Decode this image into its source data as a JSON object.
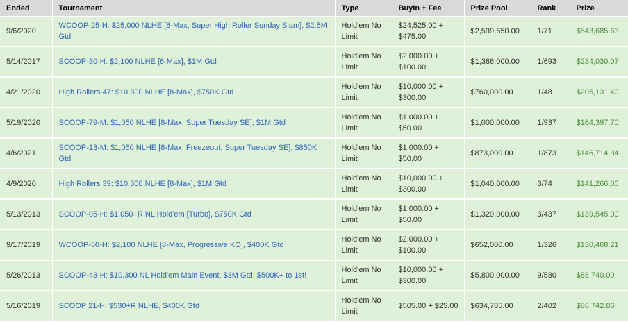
{
  "columns": [
    "Ended",
    "Tournament",
    "Type",
    "BuyIn + Fee",
    "Prize Pool",
    "Rank",
    "Prize"
  ],
  "rows": [
    {
      "ended": "9/6/2020",
      "tournament": "WCOOP-25-H: $25,000 NLHE [8-Max, Super High Roller Sunday Slam], $2.5M Gtd",
      "type": "Hold'em No Limit",
      "buyin": "$24,525.00 + $475.00",
      "pool": "$2,599,650.00",
      "rank": "1/71",
      "prize": "$543,685.63"
    },
    {
      "ended": "5/14/2017",
      "tournament": "SCOOP-30-H: $2,100 NLHE [6-Max], $1M Gtd",
      "type": "Hold'em No Limit",
      "buyin": "$2,000.00 + $100.00",
      "pool": "$1,386,000.00",
      "rank": "1/693",
      "prize": "$234,030.07"
    },
    {
      "ended": "4/21/2020",
      "tournament": "High Rollers 47: $10,300 NLHE [8-Max], $750K Gtd",
      "type": "Hold'em No Limit",
      "buyin": "$10,000.00 + $300.00",
      "pool": "$760,000.00",
      "rank": "1/48",
      "prize": "$205,131.40"
    },
    {
      "ended": "5/19/2020",
      "tournament": "SCOOP-79-M: $1,050 NLHE [8-Max, Super Tuesday SE], $1M Gtd",
      "type": "Hold'em No Limit",
      "buyin": "$1,000.00 + $50.00",
      "pool": "$1,000,000.00",
      "rank": "1/937",
      "prize": "$164,397.70"
    },
    {
      "ended": "4/6/2021",
      "tournament": "SCOOP-13-M: $1,050 NLHE [8-Max, Freezeout, Super Tuesday SE], $850K Gtd",
      "type": "Hold'em No Limit",
      "buyin": "$1,000.00 + $50.00",
      "pool": "$873,000.00",
      "rank": "1/873",
      "prize": "$146,714.34"
    },
    {
      "ended": "4/9/2020",
      "tournament": "High Rollers 39: $10,300 NLHE [8-Max], $1M Gtd",
      "type": "Hold'em No Limit",
      "buyin": "$10,000.00 + $300.00",
      "pool": "$1,040,000.00",
      "rank": "3/74",
      "prize": "$141,266.00"
    },
    {
      "ended": "5/13/2013",
      "tournament": "SCOOP-05-H: $1,050+R NL Hold'em [Turbo], $750K Gtd",
      "type": "Hold'em No Limit",
      "buyin": "$1,000.00 + $50.00",
      "pool": "$1,329,000.00",
      "rank": "3/437",
      "prize": "$139,545.00"
    },
    {
      "ended": "9/17/2019",
      "tournament": "WCOOP-50-H: $2,100 NLHE [8-Max, Progressive KO], $400K Gtd",
      "type": "Hold'em No Limit",
      "buyin": "$2,000.00 + $100.00",
      "pool": "$652,000.00",
      "rank": "1/326",
      "prize": "$130,468.21"
    },
    {
      "ended": "5/26/2013",
      "tournament": "SCOOP-43-H: $10,300 NL Hold'em Main Event, $3M Gtd, $500K+ to 1st!",
      "type": "Hold'em No Limit",
      "buyin": "$10,000.00 + $300.00",
      "pool": "$5,800,000.00",
      "rank": "9/580",
      "prize": "$88,740.00"
    },
    {
      "ended": "5/16/2019",
      "tournament": "SCOOP 21-H: $530+R NLHE, $400K Gtd",
      "type": "Hold'em No Limit",
      "buyin": "$505.00 + $25.00",
      "pool": "$634,785.00",
      "rank": "2/402",
      "prize": "$86,742.86"
    }
  ]
}
